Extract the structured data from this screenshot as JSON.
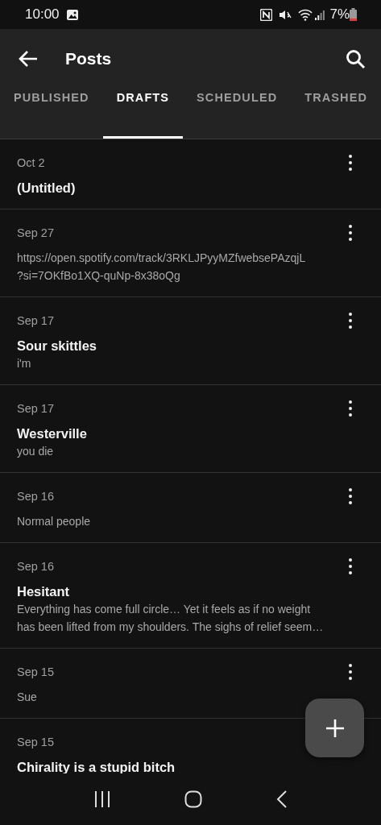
{
  "status_bar": {
    "time": "10:00",
    "battery": "7%"
  },
  "app_bar": {
    "title": "Posts"
  },
  "tabs": [
    {
      "label": "PUBLISHED",
      "selected": false
    },
    {
      "label": "DRAFTS",
      "selected": true
    },
    {
      "label": "SCHEDULED",
      "selected": false
    },
    {
      "label": "TRASHED",
      "selected": false
    }
  ],
  "posts": [
    {
      "date": "Oct 2",
      "title": "(Untitled)",
      "menu": true
    },
    {
      "date": "Sep 27",
      "body_lines": [
        "https://open.spotify.com/track/3RKLJPyyMZfwebsePAzqjL",
        "?si=7OKfBo1XQ-quNp-8x38oQg"
      ],
      "menu": true
    },
    {
      "date": "Sep 17",
      "title": "Sour skittles",
      "body_lines": [
        "i'm"
      ],
      "menu": true
    },
    {
      "date": "Sep 17",
      "title": "Westerville",
      "body_lines": [
        "you die"
      ],
      "menu": true
    },
    {
      "date": "Sep 16",
      "body_lines": [
        "Normal people"
      ],
      "menu": true
    },
    {
      "date": "Sep 16",
      "title": "Hesitant",
      "body_lines": [
        "Everything has come full circle… Yet it feels as if no weight",
        "has been lifted from my shoulders. The sighs of relief seem…"
      ],
      "menu": true
    },
    {
      "date": "Sep 15",
      "body_lines": [
        "Sue"
      ],
      "menu": true
    },
    {
      "date": "Sep 15",
      "title": "Chirality is a stupid bitch",
      "menu": false
    }
  ]
}
